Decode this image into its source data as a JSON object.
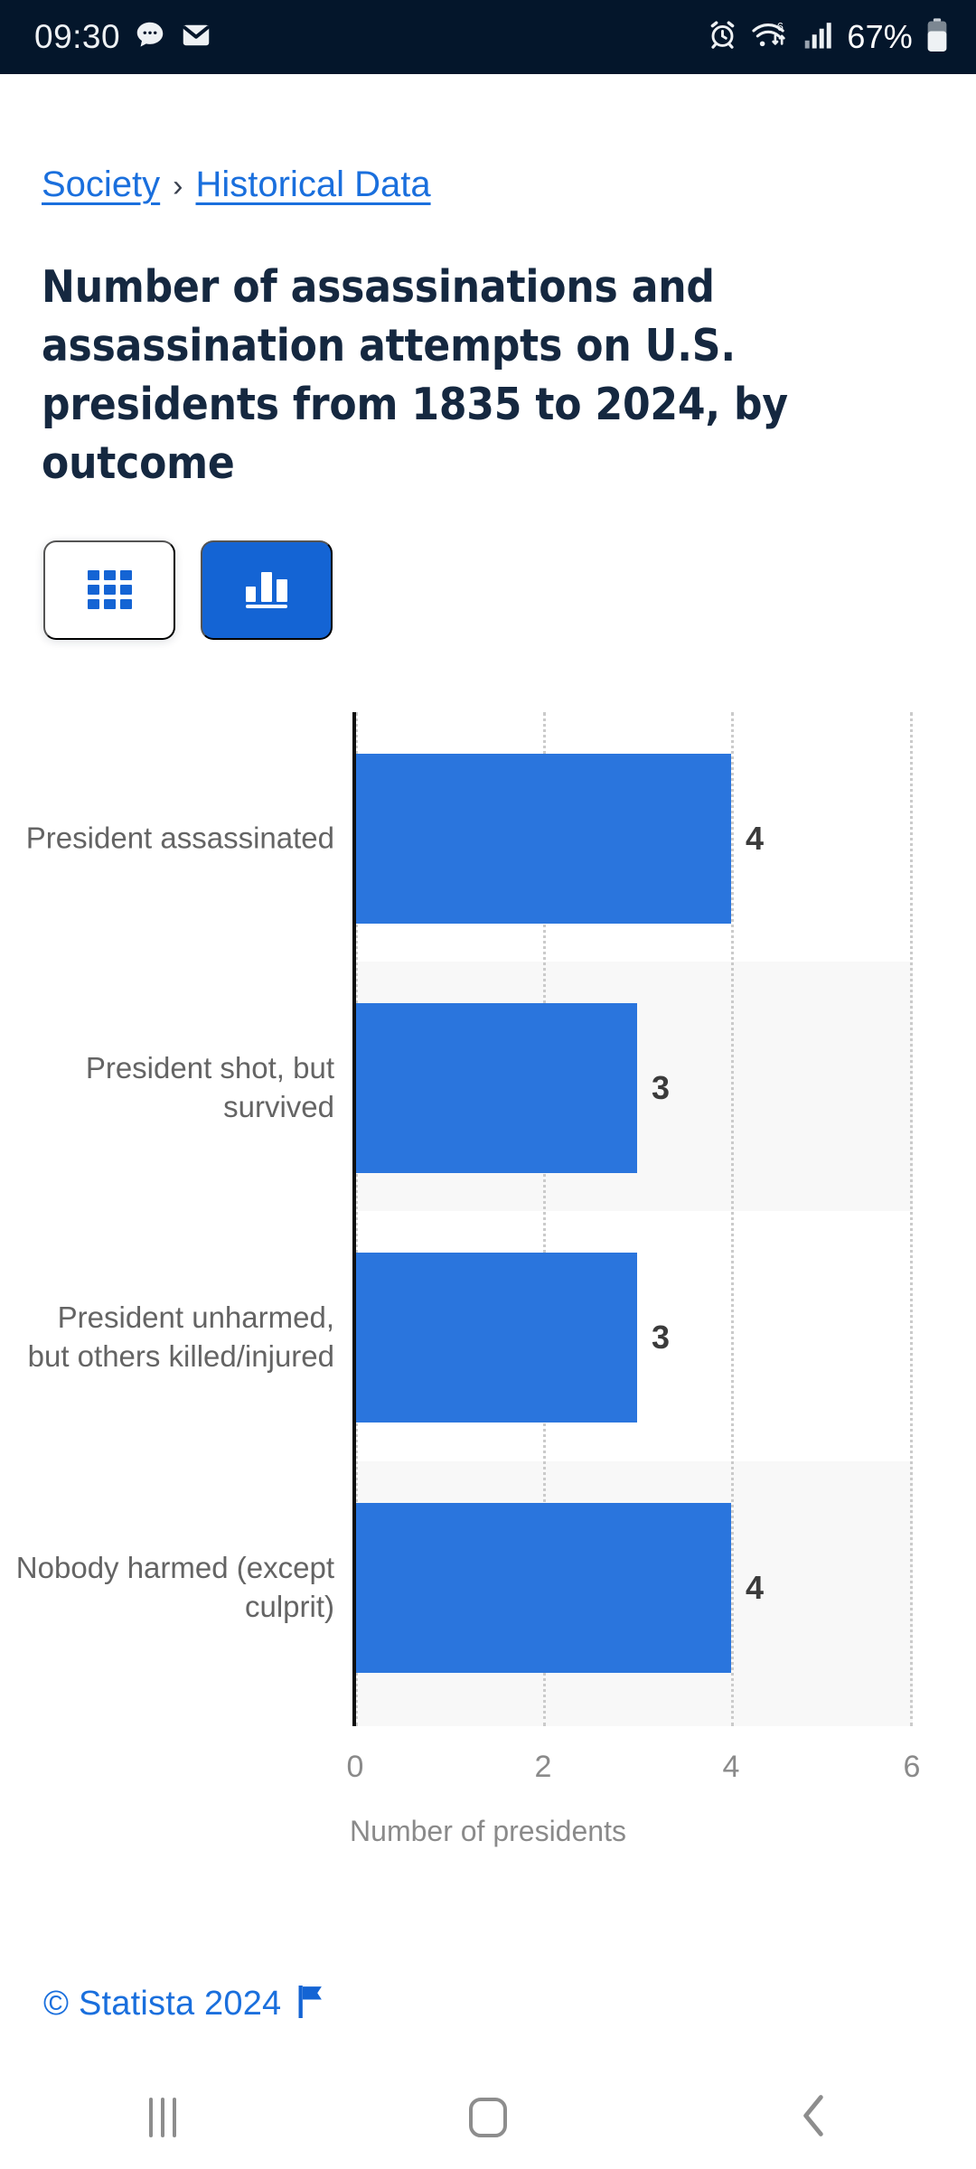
{
  "status_bar": {
    "time": "09:30",
    "battery_percent": "67%",
    "icons": [
      "message-bubble-icon",
      "email-icon",
      "alarm-icon",
      "wifi-6-icon",
      "signal-bars-icon",
      "battery-icon"
    ]
  },
  "breadcrumb": {
    "items": [
      "Society",
      "Historical Data"
    ],
    "separator": "›"
  },
  "page": {
    "title": "Number of assassinations and assassination attempts on U.S. presidents from 1835 to 2024, by outcome"
  },
  "view_toggle": {
    "table_label": "Table view",
    "chart_label": "Chart view",
    "active": "chart"
  },
  "footer": {
    "copyright": "© Statista 2024",
    "flag_icon": "flag-icon"
  },
  "navigation_bar": {
    "recents_label": "Recents",
    "home_label": "Home",
    "back_label": "Back"
  },
  "colors": {
    "bar": "#2a75dd",
    "accent": "#1464d4",
    "link": "#1a6fdd",
    "title": "#152840",
    "stripe": "#f8f8f8",
    "gridline": "#cbcbcb",
    "status_bar_bg": "#04162b"
  },
  "chart_data": {
    "type": "bar",
    "orientation": "horizontal",
    "title": "Number of assassinations and assassination attempts on U.S. presidents from 1835 to 2024, by outcome",
    "categories": [
      "President assassinated",
      "President shot, but survived",
      "President unharmed, but others killed/injured",
      "Nobody harmed (except culprit)"
    ],
    "values": [
      4,
      3,
      3,
      4
    ],
    "data_labels": [
      "4",
      "3",
      "3",
      "4"
    ],
    "xlabel": "Number of presidents",
    "ylabel": "",
    "xlim": [
      0,
      6
    ],
    "xticks": [
      0,
      2,
      4,
      6
    ],
    "xtick_labels": [
      "0",
      "2",
      "4",
      "6"
    ],
    "grid": "vertical-dotted",
    "legend": "none",
    "series_color": "#2a75dd"
  }
}
